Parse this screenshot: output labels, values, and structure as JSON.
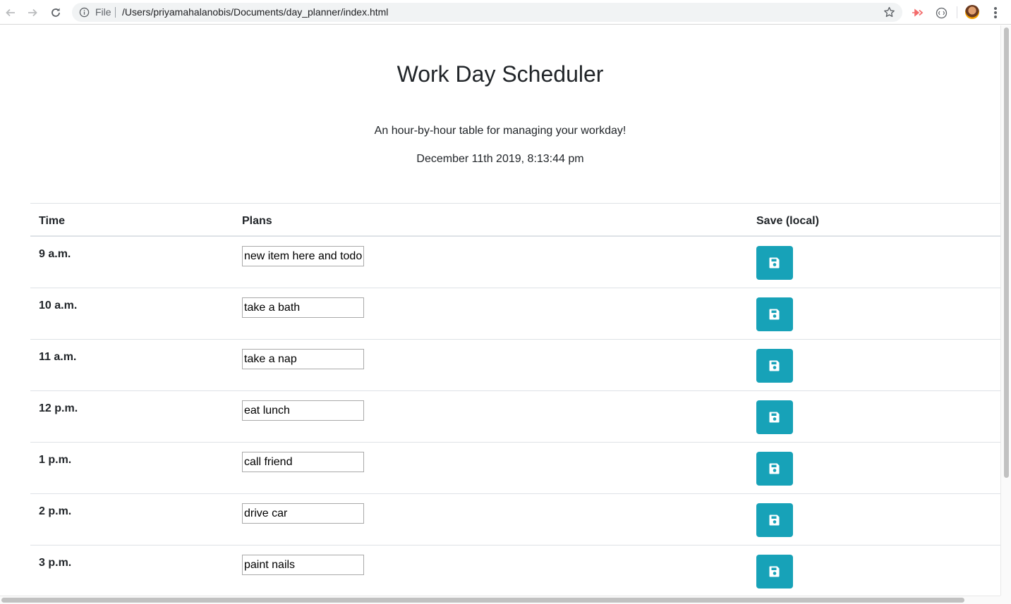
{
  "browser": {
    "omnibox_scheme": "File",
    "url": "/Users/priyamahalanobis/Documents/day_planner/index.html",
    "icons": [
      "back-arrow-icon",
      "forward-arrow-icon",
      "reload-icon",
      "info-icon",
      "star-icon",
      "extension-icon",
      "extension-icon",
      "avatar",
      "more-vert-icon"
    ]
  },
  "page": {
    "title": "Work Day Scheduler",
    "lead": "An hour-by-hour table for managing your workday!",
    "datetime": "December 11th 2019, 8:13:44 pm"
  },
  "table": {
    "headers": {
      "time": "Time",
      "plans": "Plans",
      "save": "Save (local)"
    },
    "rows": [
      {
        "time": "9 a.m.",
        "plan": "new item here and todo"
      },
      {
        "time": "10 a.m.",
        "plan": "take a bath"
      },
      {
        "time": "11 a.m.",
        "plan": "take a nap"
      },
      {
        "time": "12 p.m.",
        "plan": "eat lunch"
      },
      {
        "time": "1 p.m.",
        "plan": "call friend"
      },
      {
        "time": "2 p.m.",
        "plan": "drive car"
      },
      {
        "time": "3 p.m.",
        "plan": "paint nails"
      }
    ],
    "save_icon": "floppy-disk-icon"
  },
  "colors": {
    "save_button": "#17a2b8",
    "text": "#212529",
    "border": "#dee2e6"
  }
}
